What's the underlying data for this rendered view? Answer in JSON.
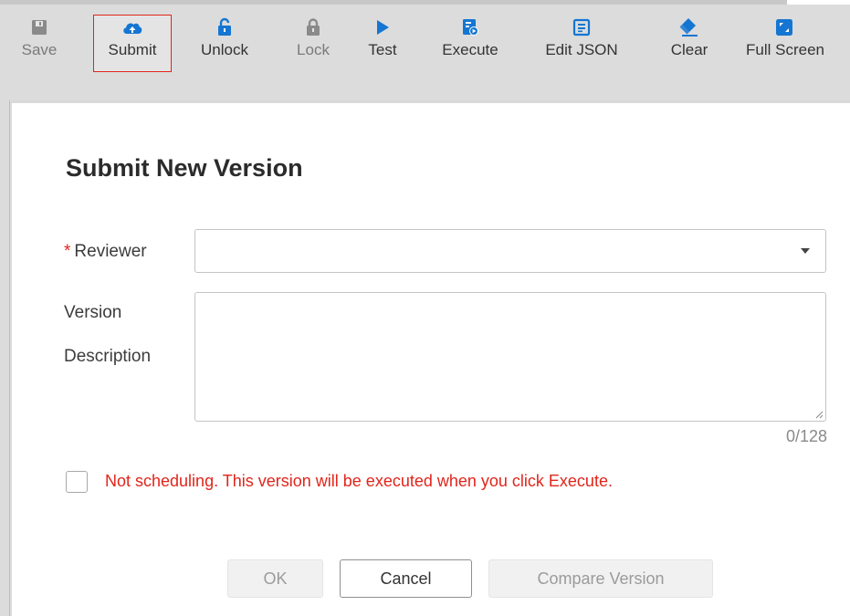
{
  "toolbar": {
    "items": [
      {
        "label": "Save",
        "icon": "floppy-icon",
        "enabled": false
      },
      {
        "label": "Submit",
        "icon": "cloud-upload-icon",
        "enabled": true,
        "highlighted": true
      },
      {
        "label": "Unlock",
        "icon": "unlock-icon",
        "enabled": true
      },
      {
        "label": "Lock",
        "icon": "lock-icon",
        "enabled": false
      },
      {
        "label": "Test",
        "icon": "play-icon",
        "enabled": true
      },
      {
        "label": "Execute",
        "icon": "execute-icon",
        "enabled": true
      },
      {
        "label": "Edit JSON",
        "icon": "edit-json-icon",
        "enabled": true
      },
      {
        "label": "Clear",
        "icon": "eraser-icon",
        "enabled": true
      },
      {
        "label": "Full Screen",
        "icon": "fullscreen-icon",
        "enabled": true
      }
    ]
  },
  "dialog": {
    "title": "Submit New Version",
    "reviewer": {
      "required_mark": "*",
      "label": "Reviewer",
      "value": ""
    },
    "description": {
      "label_line1": "Version",
      "label_line2": "Description",
      "value": "",
      "counter": "0/128"
    },
    "checkbox": {
      "checked": false,
      "text": "Not scheduling. This version will be executed when you click Execute."
    },
    "buttons": {
      "ok": "OK",
      "cancel": "Cancel",
      "compare": "Compare Version"
    }
  },
  "colors": {
    "accent_blue": "#1476d2",
    "highlight_red": "#e1251b",
    "toolbar_bg": "#dcdcdc"
  }
}
